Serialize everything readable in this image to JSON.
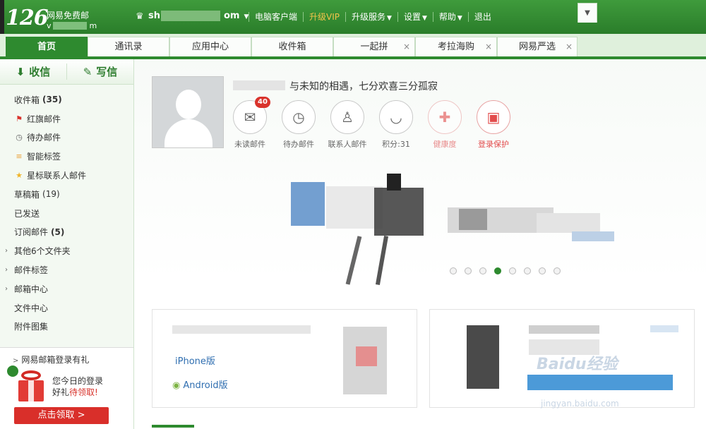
{
  "brand": {
    "logo": "126",
    "subtitle": "网易免费邮",
    "account_short": "v",
    "account_tail": "m"
  },
  "user": {
    "account_prefix": "sh",
    "account_suffix": "om"
  },
  "topnav": [
    {
      "label": "电脑客户端",
      "dropdown": false,
      "vip": false
    },
    {
      "label": "升级VIP",
      "dropdown": false,
      "vip": true
    },
    {
      "label": "升级服务",
      "dropdown": true,
      "vip": false
    },
    {
      "label": "设置",
      "dropdown": true,
      "vip": false
    },
    {
      "label": "帮助",
      "dropdown": true,
      "vip": false
    },
    {
      "label": "退出",
      "dropdown": false,
      "vip": false
    }
  ],
  "tabs": [
    {
      "label": "首页",
      "active": true,
      "closable": false
    },
    {
      "label": "通讯录",
      "active": false,
      "closable": false
    },
    {
      "label": "应用中心",
      "active": false,
      "closable": false
    },
    {
      "label": "收件箱",
      "active": false,
      "closable": false
    },
    {
      "label": "一起拼",
      "active": false,
      "closable": true
    },
    {
      "label": "考拉海购",
      "active": false,
      "closable": true
    },
    {
      "label": "网易严选",
      "active": false,
      "closable": true
    }
  ],
  "sidebar": {
    "receive_label": "收信",
    "compose_label": "写信",
    "folders": [
      {
        "label": "收件箱",
        "count": "(35)",
        "bold_count": true,
        "icon": "",
        "expandable": false
      },
      {
        "label": "红旗邮件",
        "count": "",
        "icon": "flag-icon",
        "expandable": false
      },
      {
        "label": "待办邮件",
        "count": "",
        "icon": "clock-icon",
        "expandable": false
      },
      {
        "label": "智能标签",
        "count": "",
        "icon": "tag-stack-icon",
        "expandable": false
      },
      {
        "label": "星标联系人邮件",
        "count": "",
        "icon": "star-icon",
        "expandable": false
      },
      {
        "label": "草稿箱",
        "count": "(19)",
        "bold_count": false,
        "icon": "",
        "expandable": false
      },
      {
        "label": "已发送",
        "count": "",
        "icon": "",
        "expandable": false
      },
      {
        "label": "订阅邮件",
        "count": "(5)",
        "bold_count": true,
        "icon": "",
        "expandable": false
      },
      {
        "label": "其他6个文件夹",
        "count": "",
        "icon": "",
        "expandable": true
      },
      {
        "label": "邮件标签",
        "count": "",
        "icon": "",
        "expandable": true
      },
      {
        "label": "邮箱中心",
        "count": "",
        "icon": "",
        "expandable": true
      },
      {
        "label": "文件中心",
        "count": "",
        "icon": "",
        "expandable": false
      },
      {
        "label": "附件图集",
        "count": "",
        "icon": "",
        "expandable": false
      }
    ],
    "promo": {
      "title": "网易邮箱登录有礼",
      "line1": "您今日的登录",
      "line2_prefix": "好礼",
      "line2_highlight": "待领取!",
      "button": "点击领取 >"
    }
  },
  "profile": {
    "motto": "与未知的相遇，七分欢喜三分孤寂"
  },
  "quick_actions": [
    {
      "label": "未读邮件",
      "icon": "envelope-icon",
      "badge": "40",
      "style": "normal"
    },
    {
      "label": "待办邮件",
      "icon": "clock-icon",
      "badge": "",
      "style": "normal"
    },
    {
      "label": "联系人邮件",
      "icon": "contact-star-icon",
      "badge": "",
      "style": "normal"
    },
    {
      "label": "积分:31",
      "icon": "points-icon",
      "badge": "",
      "style": "normal"
    },
    {
      "label": "健康度",
      "icon": "health-icon",
      "badge": "",
      "style": "faded"
    },
    {
      "label": "登录保护",
      "icon": "lock-icon",
      "badge": "",
      "style": "red"
    }
  ],
  "carousel": {
    "slides": 8,
    "active_index": 3
  },
  "cards": {
    "app_links": [
      {
        "label": "iPhone版",
        "icon": "apple-icon"
      },
      {
        "label": "Android版",
        "icon": "android-icon"
      }
    ]
  },
  "watermark": {
    "brand": "Baidu经验",
    "url": "jingyan.baidu.com"
  }
}
